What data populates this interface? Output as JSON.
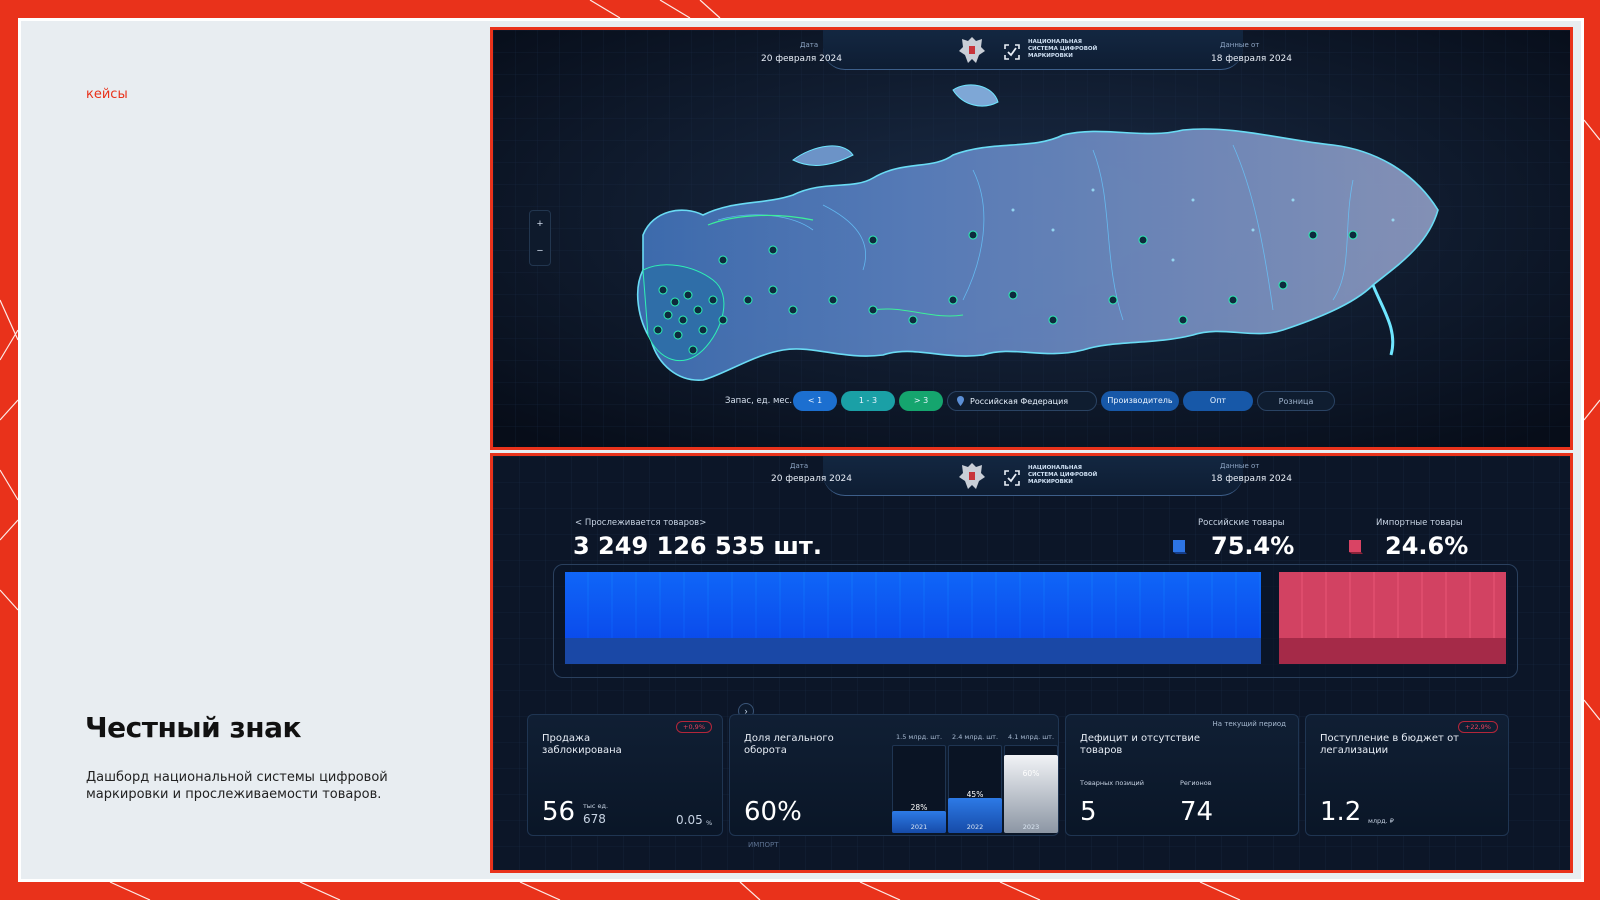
{
  "slide": {
    "tag": "кейсы",
    "title": "Честный знак",
    "description": "Дашборд национальной системы цифровой маркировки и прослеживаемости товаров."
  },
  "header": {
    "date_label": "Дата",
    "date_value": "20 февраля 2024",
    "data_label": "Данные от",
    "data_value": "18 февраля 2024",
    "org_name": "НАЦИОНАЛЬНАЯ СИСТЕМА ЦИФРОВОЙ МАРКИРОВКИ",
    "emblem_icon": "russian-emblem-icon",
    "logo_icon": "check-mark-logo-icon"
  },
  "map": {
    "zoom_in": "+",
    "zoom_out": "−",
    "stock_label": "Запас, ед. мес.",
    "stock_options": [
      "< 1",
      "1 - 3",
      "> 3"
    ],
    "region": "Российская Федерация",
    "segments": [
      "Производитель",
      "Опт",
      "Розница"
    ],
    "colors": {
      "accent_blue": "#1c6fd0",
      "accent_teal": "#1aa0a6",
      "accent_green": "#15a56e"
    }
  },
  "summary": {
    "tracked_label": "< Прослеживается товаров>",
    "tracked_value": "3 249 126 535 шт.",
    "russian_label": "Российские товары",
    "russian_value": "75.4%",
    "import_label": "Импортные товары",
    "import_value": "24.6%",
    "colors": {
      "russian": "#2d74e3",
      "import": "#d94464"
    }
  },
  "chart_data": {
    "type": "bar",
    "categories": [
      "Российские товары",
      "Импортные товары"
    ],
    "values": [
      75.4,
      24.6
    ],
    "title": "",
    "xlabel": "",
    "ylabel": ""
  },
  "cards": {
    "blocked": {
      "title": "Продажа заблокирована",
      "badge": "+0,9%",
      "value": "56",
      "unit": "тыс ед.",
      "sub": "678",
      "pct": "0.05",
      "pct_unit": "%"
    },
    "legal": {
      "title": "Доля легального оборота",
      "value": "60%",
      "columns": [
        {
          "label": "1.5 млрд. шт.",
          "year": "2021",
          "pct": "28%",
          "fill": 0.28
        },
        {
          "label": "2.4 млрд. шт.",
          "year": "2022",
          "pct": "45%",
          "fill": 0.45
        },
        {
          "label": "4.1 млрд. шт.",
          "year": "2023",
          "pct": "60%",
          "fill": 1.0
        }
      ]
    },
    "deficit": {
      "title": "Дефицит и отсутствие товаров",
      "period": "На текущий период",
      "positions_label": "Товарных позиций",
      "positions_value": "5",
      "regions_label": "Регионов",
      "regions_value": "74"
    },
    "budget": {
      "title": "Поступление в бюджет от легализации",
      "badge": "+22,9%",
      "value": "1.2",
      "unit": "млрд. ₽"
    },
    "import_label": "ИМПОРТ",
    "expand_icon": "chevron-right-icon"
  }
}
